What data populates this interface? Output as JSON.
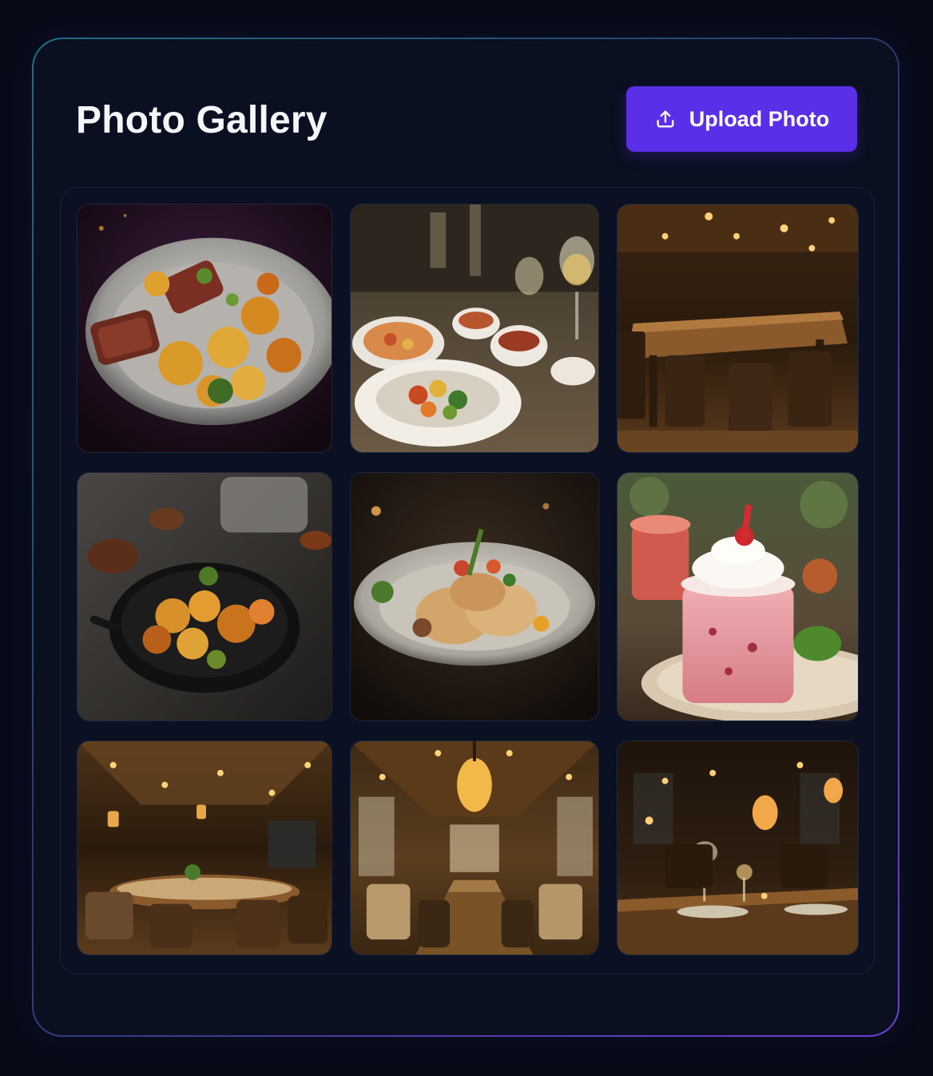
{
  "gallery": {
    "title": "Photo Gallery",
    "upload_label": "Upload Photo",
    "upload_icon": "upload-icon",
    "accent_color": "#5b2ee8"
  },
  "photos": [
    {
      "subject": "grilled steak with roasted potatoes on a plate"
    },
    {
      "subject": "set dinner table with bowls and wine glasses"
    },
    {
      "subject": "warm-lit restaurant dining room with wooden tables"
    },
    {
      "subject": "roasted potatoes and vegetables in a cast iron skillet"
    },
    {
      "subject": "grilled chicken with herbs on a plate"
    },
    {
      "subject": "strawberry milkshake with whipped cream"
    },
    {
      "subject": "restaurant hall with hanging lanterns"
    },
    {
      "subject": "long banquet dining room with chandelier"
    },
    {
      "subject": "candlelit restaurant table with wine glasses"
    }
  ]
}
